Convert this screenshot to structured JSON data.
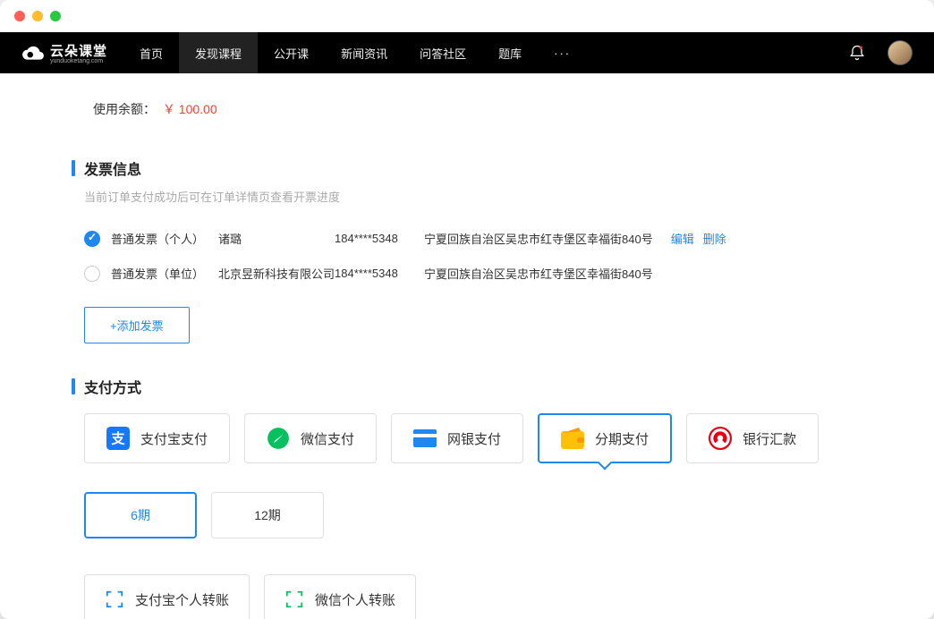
{
  "nav": {
    "brand": "云朵课堂",
    "brand_sub": "yunduoketang.com",
    "items": [
      "首页",
      "发现课程",
      "公开课",
      "新闻资讯",
      "问答社区",
      "题库"
    ],
    "active_index": 1
  },
  "balance": {
    "label": "使用余额：",
    "amount": "￥ 100.00"
  },
  "invoice": {
    "title": "发票信息",
    "subtitle": "当前订单支付成功后可在订单详情页查看开票进度",
    "rows": [
      {
        "type": "普通发票（个人）",
        "name": "诸璐",
        "phone": "184****5348",
        "address": "宁夏回族自治区吴忠市红寺堡区幸福街840号",
        "checked": true,
        "show_actions": true
      },
      {
        "type": "普通发票（单位）",
        "name": "北京昱新科技有限公司",
        "phone": "184****5348",
        "address": "宁夏回族自治区吴忠市红寺堡区幸福街840号",
        "checked": false,
        "show_actions": false
      }
    ],
    "edit": "编辑",
    "delete": "删除",
    "add_button": "+添加发票"
  },
  "payment": {
    "title": "支付方式",
    "methods": [
      "支付宝支付",
      "微信支付",
      "网银支付",
      "分期支付",
      "银行汇款"
    ],
    "selected_index": 3,
    "installments": [
      "6期",
      "12期"
    ],
    "installment_selected": 0,
    "transfers": [
      "支付宝个人转账",
      "微信个人转账"
    ]
  }
}
